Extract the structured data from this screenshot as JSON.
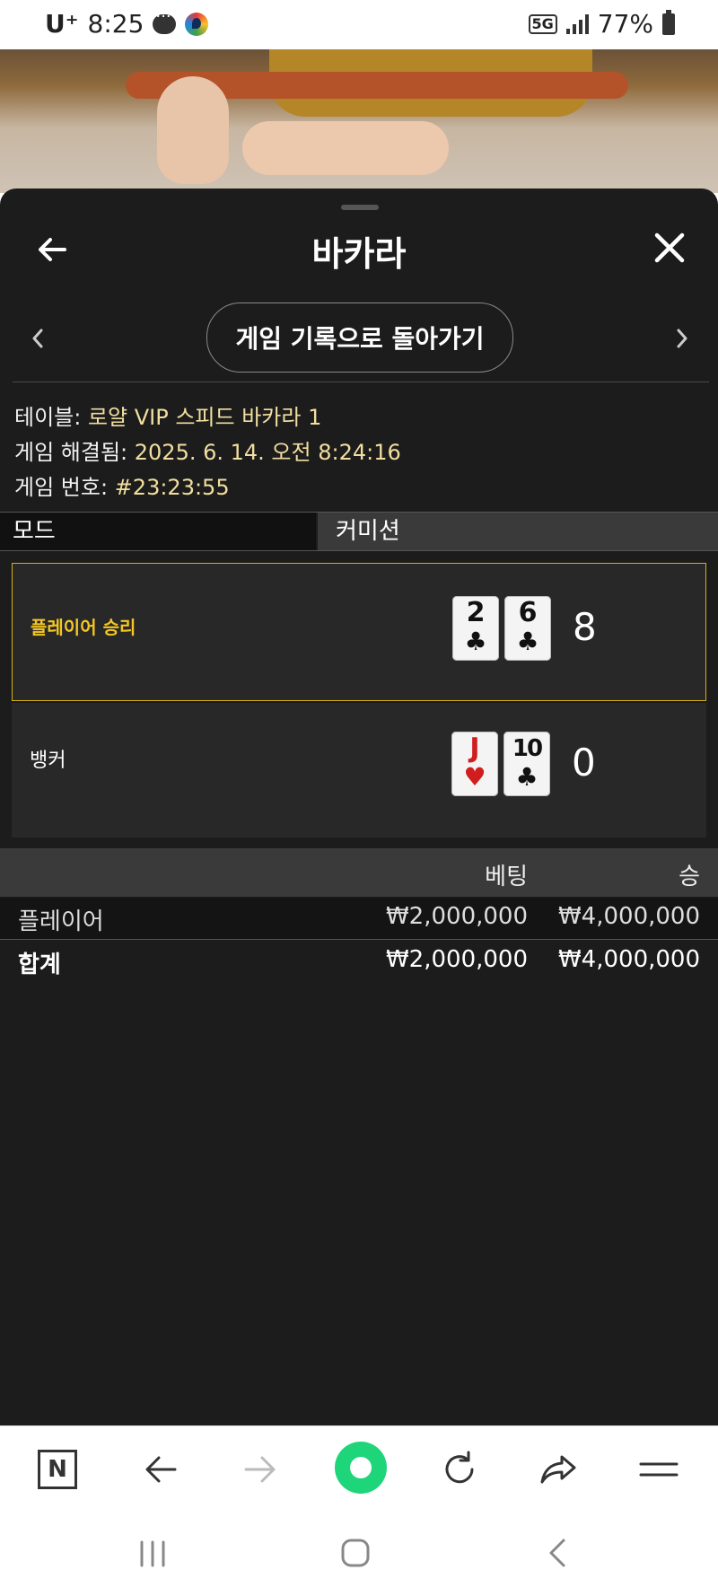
{
  "status_bar": {
    "carrier": "U⁺",
    "time": "8:25",
    "network": "5G",
    "battery": "77%"
  },
  "panel": {
    "title": "바카라",
    "history_button": "게임 기록으로 돌아가기"
  },
  "game_info": {
    "table_label": "테이블:",
    "table_value": "로얄 VIP 스피드 바카라 1",
    "resolved_label": "게임 해결됨:",
    "resolved_value": "2025. 6. 14. 오전 8:24:16",
    "number_label": "게임 번호:",
    "number_value": "#23:23:55"
  },
  "tabs": {
    "mode": "모드",
    "commission": "커미션"
  },
  "results": {
    "player": {
      "label": "플레이어 승리",
      "cards": [
        {
          "rank": "2",
          "suit": "♣",
          "color": "#111111"
        },
        {
          "rank": "6",
          "suit": "♣",
          "color": "#111111"
        }
      ],
      "score": "8"
    },
    "banker": {
      "label": "뱅커",
      "cards": [
        {
          "rank": "J",
          "suit": "♥",
          "color": "#d11d1d"
        },
        {
          "rank": "10",
          "suit": "♣",
          "color": "#111111"
        }
      ],
      "score": "0"
    }
  },
  "bets": {
    "headers": {
      "bet": "베팅",
      "win": "승"
    },
    "rows": [
      {
        "name": "플레이어",
        "bet": "₩2,000,000",
        "win": "₩4,000,000"
      },
      {
        "name": "합계",
        "bet": "₩2,000,000",
        "win": "₩4,000,000"
      }
    ]
  },
  "browser": {
    "naver_letter": "N"
  },
  "colors": {
    "accent_gold": "#d4b018",
    "panel_bg": "#1c1c1c",
    "green": "#1ed57a"
  },
  "icons": [
    "back-arrow-icon",
    "close-icon",
    "chevron-left-icon",
    "chevron-right-icon",
    "naver-icon",
    "forward-icon",
    "refresh-icon",
    "share-icon",
    "menu-icon",
    "recent-apps-icon",
    "home-icon",
    "system-back-icon"
  ]
}
